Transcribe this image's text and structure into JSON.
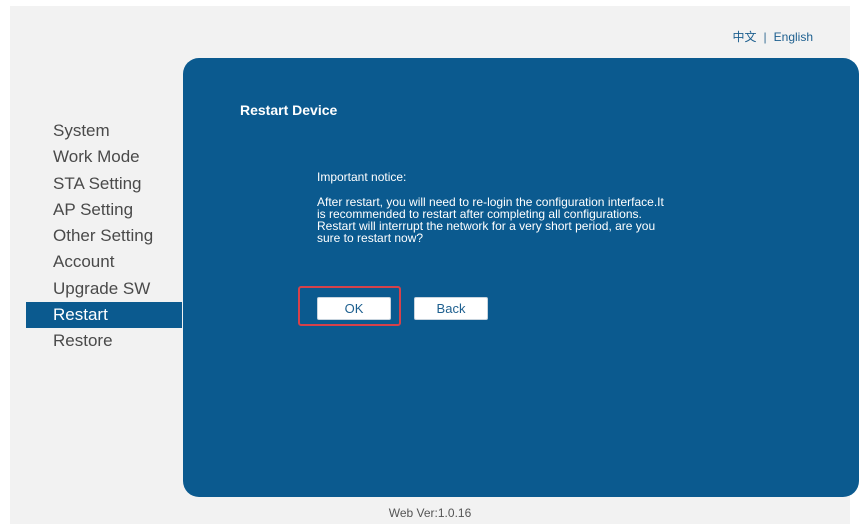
{
  "lang": {
    "chinese": "中文",
    "separator": "|",
    "english": "English"
  },
  "sidebar": {
    "items": [
      {
        "label": "System"
      },
      {
        "label": "Work Mode"
      },
      {
        "label": "STA Setting"
      },
      {
        "label": "AP Setting"
      },
      {
        "label": "Other Setting"
      },
      {
        "label": "Account"
      },
      {
        "label": "Upgrade SW"
      },
      {
        "label": "Restart",
        "active": true
      },
      {
        "label": "Restore"
      }
    ]
  },
  "main": {
    "title": "Restart Device",
    "notice_heading": "Important notice:",
    "notice_lines": [
      "After restart, you will need to re-login the configuration interface.It",
      "is recommended to restart after completing all configurations.",
      "Restart will interrupt the network for a very short period, are you",
      "sure to restart now?"
    ],
    "ok_label": "OK",
    "back_label": "Back"
  },
  "footer": {
    "version": "Web Ver:1.0.16"
  },
  "colors": {
    "panel": "#0b5a8f",
    "active_item": "#0b5a8f",
    "highlight": "#d6414a"
  }
}
